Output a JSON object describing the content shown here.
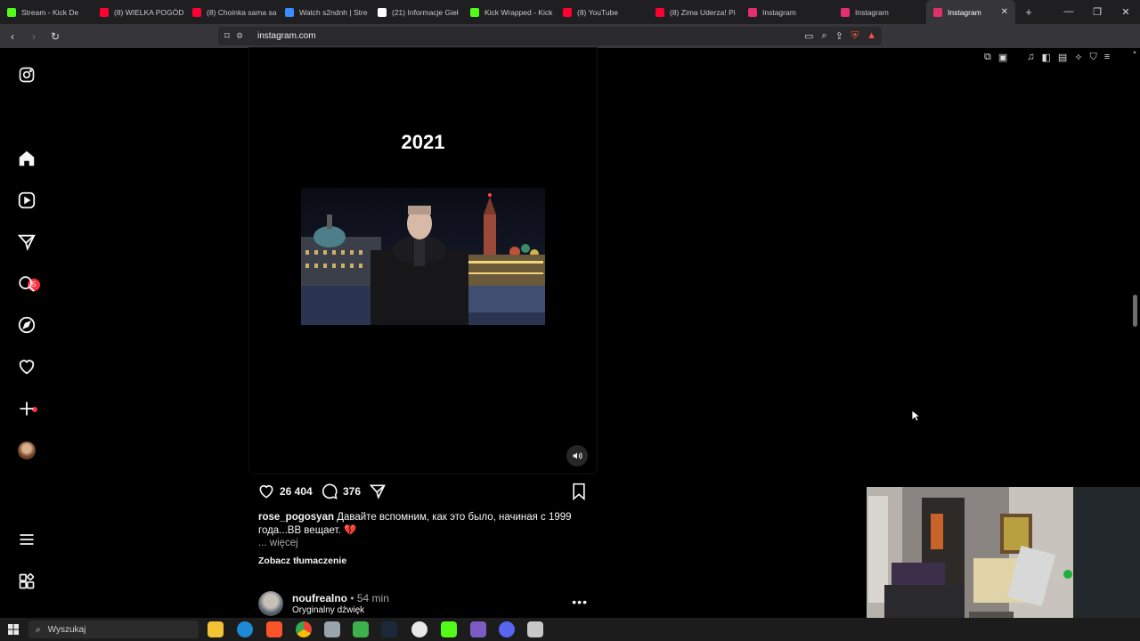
{
  "browser": {
    "tabs": [
      {
        "title": "Stream - Kick De",
        "color": "#53fc18"
      },
      {
        "title": "(8) WIELKA POGÓD",
        "color": "#ff0033"
      },
      {
        "title": "(8) Choinka sama sa",
        "color": "#ff0033"
      },
      {
        "title": "Watch s2ndnh | Stre",
        "color": "#3b8cff"
      },
      {
        "title": "(21) Informacje Gieł",
        "color": "#ffffff"
      },
      {
        "title": "Kick Wrapped - Kick",
        "color": "#53fc18"
      },
      {
        "title": "(8) YouTube",
        "color": "#ff0033"
      },
      {
        "title": "(8) Zima Uderza! Pi",
        "color": "#ff0033"
      },
      {
        "title": "Instagram",
        "color": "#e1306c"
      },
      {
        "title": "Instagram",
        "color": "#e1306c"
      },
      {
        "title": "Instagram",
        "color": "#e1306c",
        "active": true
      }
    ],
    "url": "instagram.com"
  },
  "sidebar": {
    "items": [
      "instagram-logo",
      "home",
      "reels",
      "messages",
      "search",
      "explore",
      "notifications",
      "create",
      "profile",
      "more",
      "also-from-meta"
    ],
    "messages_badge": "5"
  },
  "reel": {
    "year": "2021"
  },
  "actions": {
    "likes": "26 404",
    "comments": "376"
  },
  "caption": {
    "username": "rose_pogosyan",
    "text": "Давайте вспомним, как это было, начиная с 1999 года...ВВ вещает.",
    "more": "... więcej",
    "translate": "Zobacz tłumaczenie"
  },
  "next_post": {
    "username": "noufrealno",
    "time": "• 54 min",
    "audio": "Oryginalny dźwięk"
  },
  "taskbar": {
    "search_placeholder": "Wyszukaj"
  },
  "colors": {
    "accent_red": "#ff3040",
    "background": "#000000"
  }
}
